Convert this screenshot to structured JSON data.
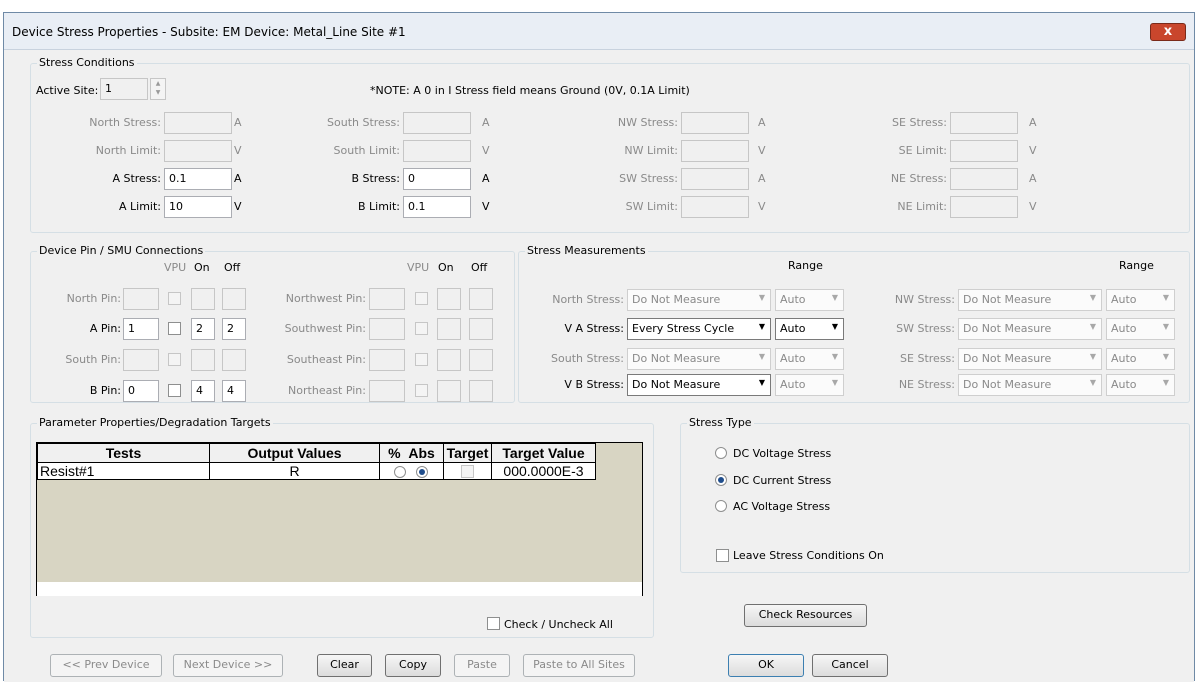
{
  "window": {
    "title": "Device Stress Properties -  Subsite: EM  Device: Metal_Line  Site #1",
    "close_label": "x"
  },
  "stress_conditions": {
    "group_label": "Stress Conditions",
    "active_site_label": "Active Site:",
    "active_site_value": "1",
    "note": "*NOTE: A 0 in I Stress field means Ground (0V, 0.1A Limit)",
    "rows": [
      [
        {
          "label": "North Stress:",
          "value": "",
          "unit": "A",
          "enabled": false
        },
        {
          "label": "South Stress:",
          "value": "",
          "unit": "A",
          "enabled": false
        },
        {
          "label": "NW Stress:",
          "value": "",
          "unit": "A",
          "enabled": false
        },
        {
          "label": "SE Stress:",
          "value": "",
          "unit": "A",
          "enabled": false
        }
      ],
      [
        {
          "label": "North Limit:",
          "value": "",
          "unit": "V",
          "enabled": false
        },
        {
          "label": "South Limit:",
          "value": "",
          "unit": "V",
          "enabled": false
        },
        {
          "label": "NW Limit:",
          "value": "",
          "unit": "V",
          "enabled": false
        },
        {
          "label": "SE Limit:",
          "value": "",
          "unit": "V",
          "enabled": false
        }
      ],
      [
        {
          "label": "A Stress:",
          "value": "0.1",
          "unit": "A",
          "enabled": true
        },
        {
          "label": "B Stress:",
          "value": "0",
          "unit": "A",
          "enabled": true
        },
        {
          "label": "SW Stress:",
          "value": "",
          "unit": "A",
          "enabled": false
        },
        {
          "label": "NE Stress:",
          "value": "",
          "unit": "A",
          "enabled": false
        }
      ],
      [
        {
          "label": "A Limit:",
          "value": "10",
          "unit": "V",
          "enabled": true
        },
        {
          "label": "B Limit:",
          "value": "0.1",
          "unit": "V",
          "enabled": true
        },
        {
          "label": "SW Limit:",
          "value": "",
          "unit": "V",
          "enabled": false
        },
        {
          "label": "NE Limit:",
          "value": "",
          "unit": "V",
          "enabled": false
        }
      ]
    ]
  },
  "pins": {
    "group_label": "Device Pin / SMU Connections",
    "col_headers": [
      "VPU",
      "On",
      "Off"
    ],
    "left": [
      {
        "label": "North Pin:",
        "pin": "",
        "on": "",
        "off": "",
        "enabled": false
      },
      {
        "label": "A Pin:",
        "pin": "1",
        "on": "2",
        "off": "2",
        "enabled": true
      },
      {
        "label": "South Pin:",
        "pin": "",
        "on": "",
        "off": "",
        "enabled": false
      },
      {
        "label": "B Pin:",
        "pin": "0",
        "on": "4",
        "off": "4",
        "enabled": true
      }
    ],
    "right": [
      {
        "label": "Northwest Pin:",
        "pin": "",
        "on": "",
        "off": "",
        "enabled": false
      },
      {
        "label": "Southwest Pin:",
        "pin": "",
        "on": "",
        "off": "",
        "enabled": false
      },
      {
        "label": "Southeast Pin:",
        "pin": "",
        "on": "",
        "off": "",
        "enabled": false
      },
      {
        "label": "Northeast Pin:",
        "pin": "",
        "on": "",
        "off": "",
        "enabled": false
      }
    ]
  },
  "measurements": {
    "group_label": "Stress Measurements",
    "range_header": "Range",
    "left": [
      {
        "label": "North Stress:",
        "value": "Do Not Measure",
        "range": "Auto",
        "enabled": false,
        "range_enabled": false
      },
      {
        "label": "V A Stress:",
        "value": "Every Stress Cycle",
        "range": "Auto",
        "enabled": true,
        "range_enabled": true
      },
      {
        "label": "South Stress:",
        "value": "Do Not Measure",
        "range": "Auto",
        "enabled": false,
        "range_enabled": false
      },
      {
        "label": "V B Stress:",
        "value": "Do Not Measure",
        "range": "Auto",
        "enabled": true,
        "range_enabled": false
      }
    ],
    "right": [
      {
        "label": "NW Stress:",
        "value": "Do Not Measure",
        "range": "Auto",
        "enabled": false,
        "range_enabled": false
      },
      {
        "label": "SW Stress:",
        "value": "Do Not Measure",
        "range": "Auto",
        "enabled": false,
        "range_enabled": false
      },
      {
        "label": "SE Stress:",
        "value": "Do Not Measure",
        "range": "Auto",
        "enabled": false,
        "range_enabled": false
      },
      {
        "label": "NE Stress:",
        "value": "Do Not Measure",
        "range": "Auto",
        "enabled": false,
        "range_enabled": false
      }
    ]
  },
  "params": {
    "group_label": "Parameter Properties/Degradation Targets",
    "columns": [
      "Tests",
      "Output Values",
      "%",
      "Abs",
      "Target",
      "Target Value"
    ],
    "rows": [
      {
        "test": "Resist#1",
        "output": "R",
        "mode": "abs",
        "target": false,
        "target_value": "000.0000E-3"
      }
    ],
    "check_all_label": "Check / Uncheck All"
  },
  "stress_type": {
    "group_label": "Stress Type",
    "options": [
      "DC Voltage Stress",
      "DC Current Stress",
      "AC Voltage Stress"
    ],
    "selected": "DC Current Stress",
    "leave_on_label": "Leave Stress Conditions On",
    "leave_on_checked": false
  },
  "buttons": {
    "check_resources": "Check Resources",
    "prev_device": "<< Prev Device",
    "next_device": "Next Device >>",
    "clear": "Clear",
    "copy": "Copy",
    "paste": "Paste",
    "paste_all": "Paste to All Sites",
    "ok": "OK",
    "cancel": "Cancel"
  }
}
